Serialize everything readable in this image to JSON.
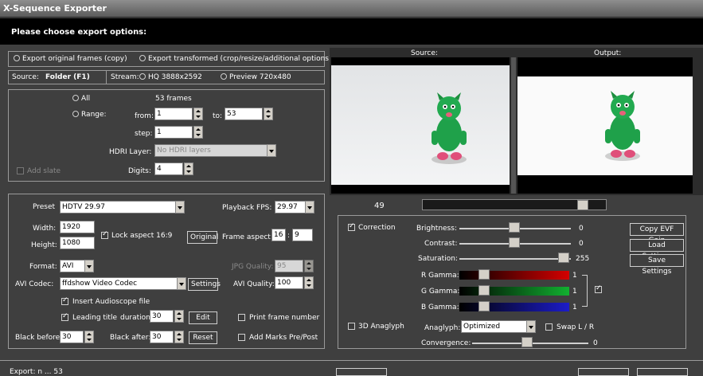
{
  "window": {
    "title": "X-Sequence Exporter"
  },
  "header": {
    "text": "Please choose export options:"
  },
  "export_mode": {
    "original": "Export original frames (copy)",
    "transformed": "Export transformed (crop/resize/additional options)"
  },
  "source": {
    "label": "Source:",
    "value": "Folder (F1)",
    "stream_label": "Stream:",
    "hq": "HQ 3888x2592",
    "preview": "Preview 720x480"
  },
  "range": {
    "all": "All",
    "frames": "53 frames",
    "range": "Range:",
    "from_label": "from:",
    "from": "1",
    "to_label": "to:",
    "to": "53",
    "step_label": "step:",
    "step": "1",
    "hdri_label": "HDRI Layer:",
    "hdri_value": "No HDRI layers",
    "add_slate": "Add slate",
    "digits_label": "Digits:",
    "digits": "4"
  },
  "format": {
    "preset_label": "Preset",
    "preset": "HDTV 29.97",
    "fps_label": "Playback FPS:",
    "fps": "29.97",
    "width_label": "Width:",
    "width": "1920",
    "height_label": "Height:",
    "height": "1080",
    "lock_aspect": "Lock aspect 16:9",
    "original_btn": "Original",
    "frame_aspect_label": "Frame aspect:",
    "aspect_w": "16",
    "aspect_h": "9",
    "format_label": "Format:",
    "format": "AVI",
    "jpg_quality_label": "JPG Quality:",
    "jpg_quality": "95",
    "codec_label": "AVI Codec:",
    "codec": "ffdshow Video Codec",
    "settings_btn": "Settings",
    "avi_quality_label": "AVI Quality:",
    "avi_quality": "100",
    "audioscope": "Insert Audioscope file",
    "leading_title": "Leading title",
    "duration_label": "duration:",
    "duration": "30",
    "edit_btn": "Edit",
    "print_frame": "Print frame number",
    "black_before_label": "Black before:",
    "black_before": "30",
    "black_after_label": "Black after:",
    "black_after": "30",
    "reset_btn": "Reset",
    "add_marks": "Add Marks Pre/Post"
  },
  "preview": {
    "source_label": "Source:",
    "output_label": "Output:",
    "frame_number": "49",
    "frame_fraction": 0.9
  },
  "correction": {
    "label": "Correction",
    "brightness_label": "Brightness:",
    "brightness": "0",
    "contrast_label": "Contrast:",
    "contrast": "0",
    "saturation_label": "Saturation:",
    "saturation": "255",
    "r_gamma_label": "R Gamma:",
    "r_gamma": "1",
    "g_gamma_label": "G Gamma:",
    "g_gamma": "1",
    "b_gamma_label": "B Gamma:",
    "b_gamma": "1",
    "copy_btn": "Copy EVF Gain",
    "load_btn": "Load Settings",
    "save_btn": "Save Settings",
    "anaglyph3d": "3D Anaglyph",
    "anaglyph_label": "Anaglyph:",
    "anaglyph_value": "Optimized",
    "swap": "Swap L / R",
    "convergence_label": "Convergence:",
    "convergence": "0"
  },
  "status": {
    "text": "Export: n ... 53"
  },
  "colors": {
    "accent_red": "#c00000",
    "accent_green": "#0f9a2f",
    "accent_blue": "#1b1bb0"
  }
}
